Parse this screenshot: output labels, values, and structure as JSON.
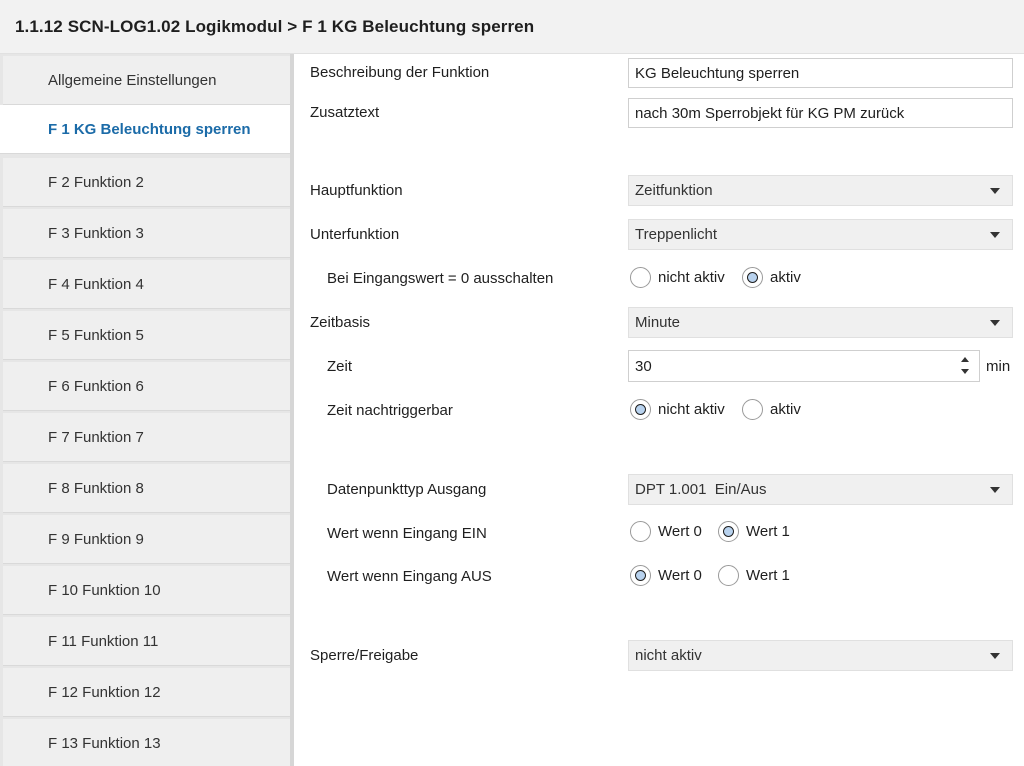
{
  "title": "1.1.12 SCN-LOG1.02 Logikmodul > F 1 KG Beleuchtung sperren",
  "sidebar": {
    "items": [
      {
        "label": "Allgemeine Einstellungen"
      },
      {
        "label": "F 1 KG Beleuchtung sperren",
        "active": true
      },
      {
        "label": "F 2 Funktion 2"
      },
      {
        "label": "F 3 Funktion 3"
      },
      {
        "label": "F 4 Funktion 4"
      },
      {
        "label": "F 5 Funktion 5"
      },
      {
        "label": "F 6 Funktion 6"
      },
      {
        "label": "F 7 Funktion 7"
      },
      {
        "label": "F 8 Funktion 8"
      },
      {
        "label": "F 9 Funktion 9"
      },
      {
        "label": "F 10 Funktion 10"
      },
      {
        "label": "F 11 Funktion 11"
      },
      {
        "label": "F 12 Funktion 12"
      },
      {
        "label": "F 13 Funktion 13"
      }
    ]
  },
  "form": {
    "beschreibung": {
      "label": "Beschreibung der Funktion",
      "value": "KG Beleuchtung sperren"
    },
    "zusatztext": {
      "label": "Zusatztext",
      "value": "nach 30m Sperrobjekt für KG PM zurück"
    },
    "hauptfunktion": {
      "label": "Hauptfunktion",
      "value": "Zeitfunktion"
    },
    "unterfunktion": {
      "label": "Unterfunktion",
      "value": "Treppenlicht"
    },
    "bei_eingang": {
      "label": "Bei Eingangswert = 0 ausschalten",
      "option1": "nicht aktiv",
      "option2": "aktiv",
      "selected": "aktiv"
    },
    "zeitbasis": {
      "label": "Zeitbasis",
      "value": "Minute"
    },
    "zeit": {
      "label": "Zeit",
      "value": "30",
      "unit": "min"
    },
    "nachtriggerbar": {
      "label": "Zeit nachtriggerbar",
      "option1": "nicht aktiv",
      "option2": "aktiv",
      "selected": "nicht aktiv"
    },
    "dpt": {
      "label": "Datenpunkttyp Ausgang",
      "value": "DPT 1.001  Ein/Aus"
    },
    "wert_ein": {
      "label": "Wert wenn Eingang EIN",
      "option1": "Wert 0",
      "option2": "Wert 1",
      "selected": "Wert 1"
    },
    "wert_aus": {
      "label": "Wert wenn Eingang AUS",
      "option1": "Wert 0",
      "option2": "Wert 1",
      "selected": "Wert 0"
    },
    "sperre": {
      "label": "Sperre/Freigabe",
      "value": "nicht aktiv"
    }
  },
  "colors": {
    "active_item": "#1b6ba8",
    "radio_selected": "#b8d2ee"
  }
}
